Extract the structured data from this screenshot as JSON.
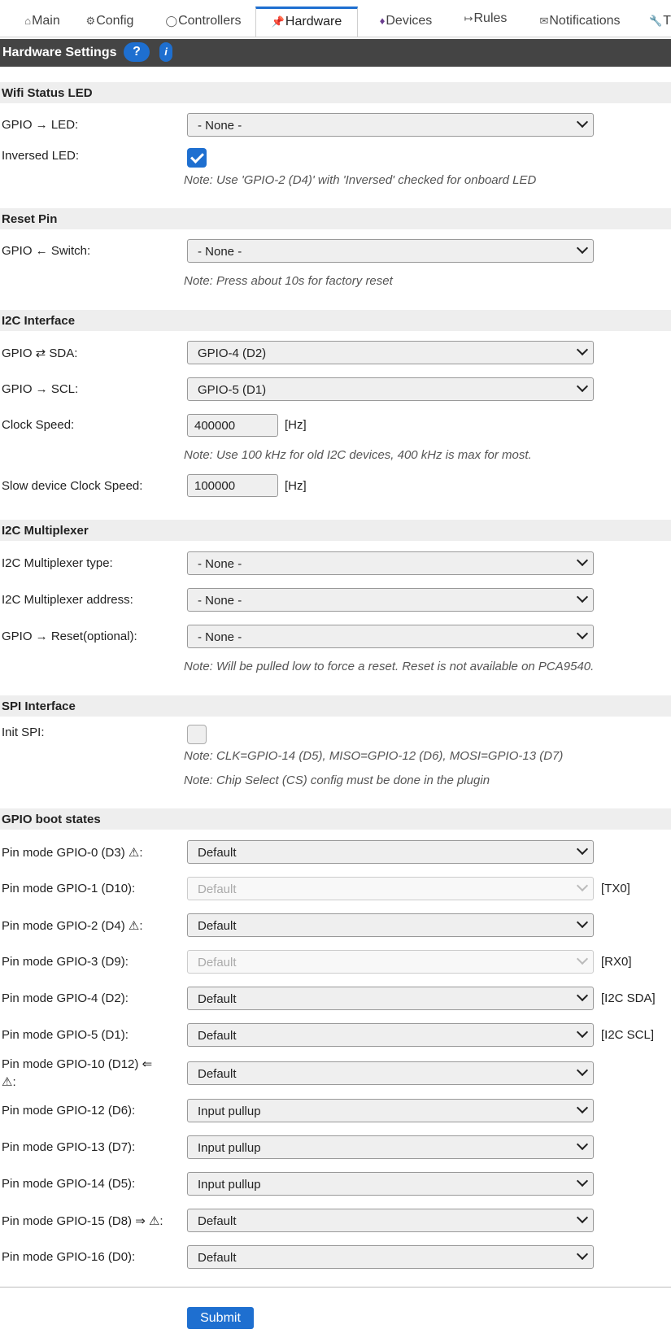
{
  "tabs": [
    {
      "icon": "⌂",
      "label": "Main"
    },
    {
      "icon": "⚙",
      "label": "Config"
    },
    {
      "icon": "◯",
      "label": "Controllers"
    },
    {
      "icon": "📌",
      "label": "Hardware"
    },
    {
      "icon": "♦",
      "label": "Devices"
    },
    {
      "icon": "↦",
      "label": "Rules"
    },
    {
      "icon": "✉",
      "label": "Notifications"
    },
    {
      "icon": "🔧",
      "label": "T"
    }
  ],
  "header": {
    "title": "Hardware Settings",
    "help": "?",
    "info": "i"
  },
  "wifi": {
    "section": "Wifi Status LED",
    "gpio_label": "GPIO → LED:",
    "gpio_value": "- None -",
    "inversed_label": "Inversed LED:",
    "inversed_checked": true,
    "note": "Note: Use 'GPIO-2 (D4)' with 'Inversed' checked for onboard LED"
  },
  "reset": {
    "section": "Reset Pin",
    "gpio_label": "GPIO ← Switch:",
    "gpio_value": "- None -",
    "note": "Note: Press about 10s for factory reset"
  },
  "i2c": {
    "section": "I2C Interface",
    "sda_label": "GPIO ⇄ SDA:",
    "sda_value": "GPIO-4 (D2)",
    "scl_label": "GPIO → SCL:",
    "scl_value": "GPIO-5 (D1)",
    "clock_label": "Clock Speed:",
    "clock_value": "400000",
    "unit": "[Hz]",
    "note": "Note: Use 100 kHz for old I2C devices, 400 kHz is max for most.",
    "slow_label": "Slow device Clock Speed:",
    "slow_value": "100000"
  },
  "mux": {
    "section": "I2C Multiplexer",
    "type_label": "I2C Multiplexer type:",
    "type_value": "- None -",
    "addr_label": "I2C Multiplexer address:",
    "addr_value": "- None -",
    "reset_label": "GPIO → Reset(optional):",
    "reset_value": "- None -",
    "note": "Note: Will be pulled low to force a reset. Reset is not available on PCA9540."
  },
  "spi": {
    "section": "SPI Interface",
    "init_label": "Init SPI:",
    "init_checked": false,
    "note1": "Note: CLK=GPIO-14 (D5), MISO=GPIO-12 (D6), MOSI=GPIO-13 (D7)",
    "note2": "Note: Chip Select (CS) config must be done in the plugin"
  },
  "boot": {
    "section": "GPIO boot states",
    "pins": [
      {
        "label": "Pin mode GPIO-0 (D3) ⚠:",
        "value": "Default",
        "disabled": false,
        "suffix": ""
      },
      {
        "label": "Pin mode GPIO-1 (D10):",
        "value": "Default",
        "disabled": true,
        "suffix": "[TX0]"
      },
      {
        "label": "Pin mode GPIO-2 (D4) ⚠:",
        "value": "Default",
        "disabled": false,
        "suffix": ""
      },
      {
        "label": "Pin mode GPIO-3 (D9):",
        "value": "Default",
        "disabled": true,
        "suffix": "[RX0]"
      },
      {
        "label": "Pin mode GPIO-4 (D2):",
        "value": "Default",
        "disabled": false,
        "suffix": "[I2C SDA]"
      },
      {
        "label": "Pin mode GPIO-5 (D1):",
        "value": "Default",
        "disabled": false,
        "suffix": "[I2C SCL]"
      },
      {
        "label": "Pin mode GPIO-10 (D12) ⇐",
        "label2": "⚠:",
        "value": "Default",
        "disabled": false,
        "suffix": ""
      },
      {
        "label": "Pin mode GPIO-12 (D6):",
        "value": "Input pullup",
        "disabled": false,
        "suffix": ""
      },
      {
        "label": "Pin mode GPIO-13 (D7):",
        "value": "Input pullup",
        "disabled": false,
        "suffix": ""
      },
      {
        "label": "Pin mode GPIO-14 (D5):",
        "value": "Input pullup",
        "disabled": false,
        "suffix": ""
      },
      {
        "label": "Pin mode GPIO-15 (D8) ⇒ ⚠:",
        "value": "Default",
        "disabled": false,
        "suffix": ""
      },
      {
        "label": "Pin mode GPIO-16 (D0):",
        "value": "Default",
        "disabled": false,
        "suffix": ""
      }
    ]
  },
  "submit_label": "Submit"
}
